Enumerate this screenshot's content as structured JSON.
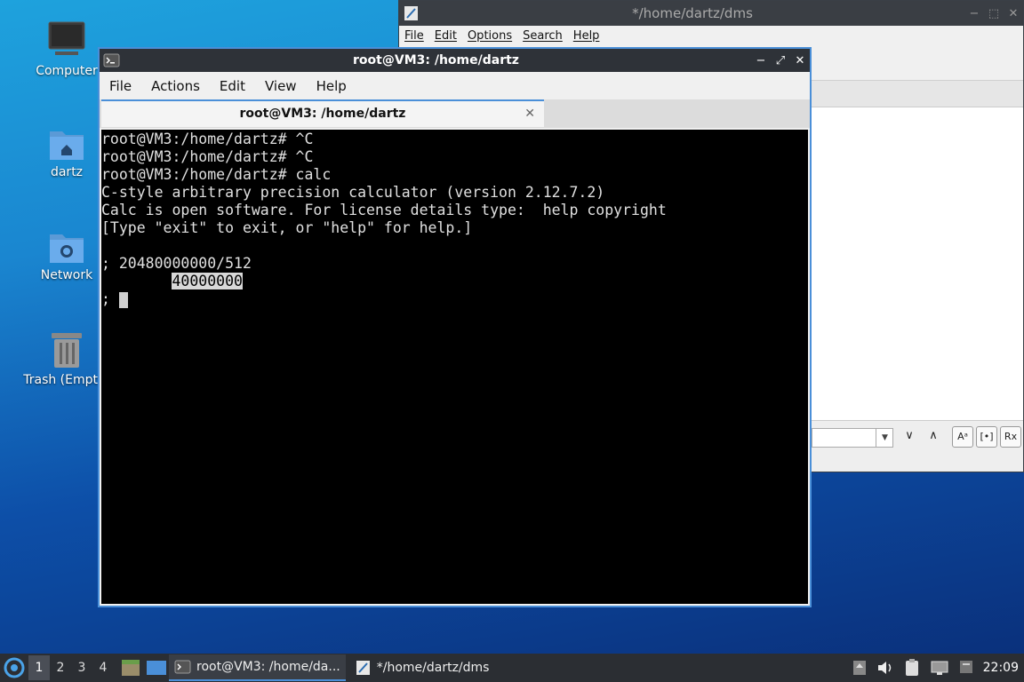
{
  "desktop": {
    "icons": [
      {
        "label": "Computer"
      },
      {
        "label": "dartz"
      },
      {
        "label": "Network"
      },
      {
        "label": "Trash (Empty)"
      }
    ]
  },
  "mousepad": {
    "title": "*/home/dartz/dms",
    "menu": [
      "File",
      "Edit",
      "Options",
      "Search",
      "Help"
    ],
    "window_controls": {
      "minimize": "−",
      "maximize": "⬚",
      "close": "✕"
    },
    "findbar": {
      "down": "∨",
      "up": "∧",
      "match_case": "Aᵃ",
      "whole_word": "[•]",
      "regex": "Rx"
    }
  },
  "terminal": {
    "title": "root@VM3: /home/dartz",
    "menu": [
      "File",
      "Actions",
      "Edit",
      "View",
      "Help"
    ],
    "window_controls": {
      "minimize": "−",
      "maximize": "⤢",
      "close": "✕"
    },
    "tab_label": "root@VM3: /home/dartz",
    "tab_close": "✕",
    "lines": [
      "root@VM3:/home/dartz# ^C",
      "root@VM3:/home/dartz# ^C",
      "root@VM3:/home/dartz# calc",
      "C-style arbitrary precision calculator (version 2.12.7.2)",
      "Calc is open software. For license details type:  help copyright",
      "[Type \"exit\" to exit, or \"help\" for help.]",
      "",
      "; 20480000000/512"
    ],
    "result_indent": "        ",
    "result": "40000000",
    "prompt": "; "
  },
  "taskbar": {
    "workspaces": [
      "1",
      "2",
      "3",
      "4"
    ],
    "active_workspace": "1",
    "tasks": [
      {
        "label": "root@VM3: /home/da..."
      },
      {
        "label": "*/home/dartz/dms"
      }
    ],
    "clock": "22:09"
  },
  "colors": {
    "accent": "#4a8fd8",
    "titlebar": "#2e3238",
    "taskbar": "#2b2e33",
    "terminal_bg": "#000000"
  }
}
